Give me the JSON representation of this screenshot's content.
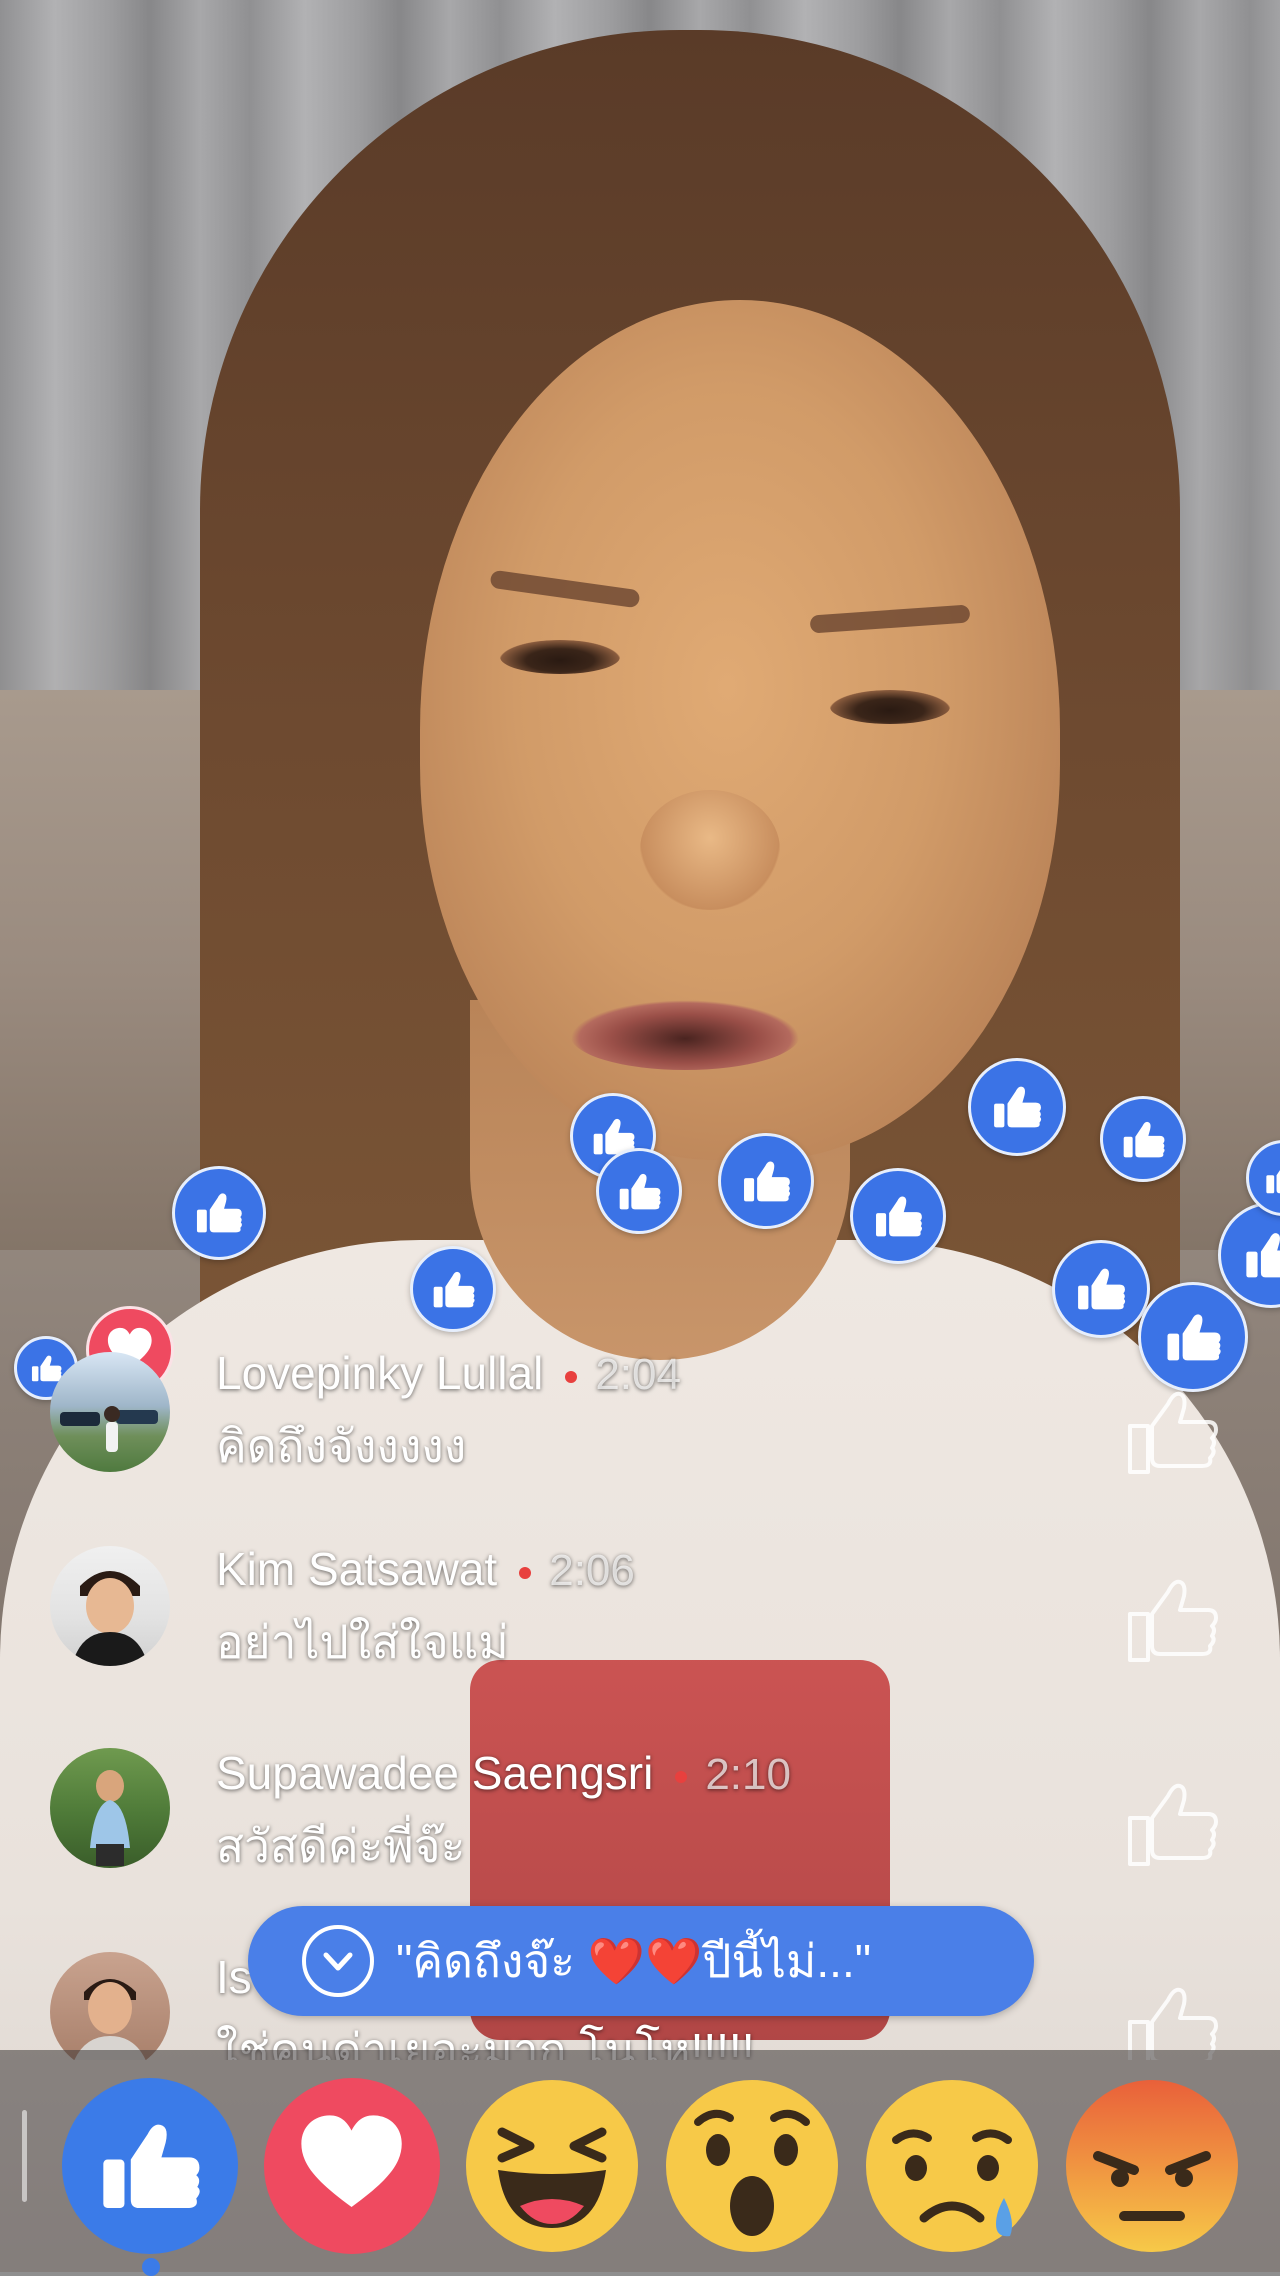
{
  "comments": [
    {
      "name": "Lovepinky Lullal",
      "time": "2:04",
      "text": "คิดถึงจังงงงง"
    },
    {
      "name": "Kim Satsawat",
      "time": "2:06",
      "text": "อย่าไปใส่ใจแม่"
    },
    {
      "name": "Supawadee Saengsri",
      "time": "2:10",
      "text": "สวัสดีค่ะพี่จ๊ะ"
    },
    {
      "name": "Is",
      "time": "",
      "text": "ใช่คนด่าเยอะมาก โนโห!!!!!"
    }
  ],
  "new_comment_banner": {
    "text": "\"คิดถึงจ๊ะ ❤️❤️ปีนี้ไม่...\""
  },
  "reactions": [
    {
      "name": "like",
      "icon": "thumbs-up-icon",
      "color": "#3b7be8"
    },
    {
      "name": "love",
      "icon": "heart-icon",
      "color": "#ef4a60"
    },
    {
      "name": "haha",
      "icon": "laughing-face-icon",
      "color": "#f7c948"
    },
    {
      "name": "wow",
      "icon": "surprised-face-icon",
      "color": "#f7c948"
    },
    {
      "name": "sad",
      "icon": "sad-face-icon",
      "color": "#f7c948"
    },
    {
      "name": "angry",
      "icon": "angry-face-icon",
      "color": "#e9603a"
    }
  ],
  "colors": {
    "like_blue": "#3b73e6",
    "love_red": "#ef4a60",
    "live_dot": "#e8403e",
    "banner_blue": "#4a7fe8"
  }
}
